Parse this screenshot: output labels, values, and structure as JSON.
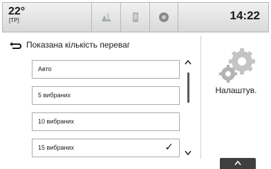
{
  "status": {
    "temperature": "22°",
    "temperature_sub": "[TP]",
    "time": "14:22"
  },
  "top_tabs": [
    {
      "icon": "audio-source-icon"
    },
    {
      "icon": "phone-icon"
    },
    {
      "icon": "info-icon"
    }
  ],
  "header": {
    "title": "Показана кількість переваг"
  },
  "list": {
    "items": [
      {
        "label": "Авто",
        "checked": false
      },
      {
        "label": "5 вибраних",
        "checked": false
      },
      {
        "label": "10 вибраних",
        "checked": false
      },
      {
        "label": "15 вибраних",
        "checked": true
      }
    ]
  },
  "settings": {
    "label": "Налаштув.",
    "icon": "gears-icon"
  },
  "colors": {
    "topbar": "#e6e6e6",
    "handle": "#3f3f3f"
  }
}
